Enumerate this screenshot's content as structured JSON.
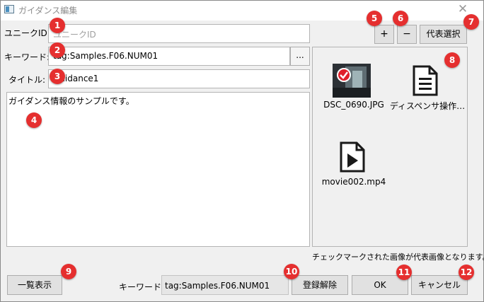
{
  "window": {
    "title": "ガイダンス編集"
  },
  "form": {
    "unique_id_label": "ユニークID:",
    "unique_id_placeholder": "ユニークID",
    "keyword_label": "キーワード:",
    "keyword_value": "tag:Samples.F06.NUM01",
    "keyword_browse": "...",
    "title_label": "タイトル:",
    "title_value": "Guidance1",
    "description": "ガイダンス情報のサンプルです。"
  },
  "media": {
    "add_label": "+",
    "remove_label": "−",
    "representative_label": "代表選択",
    "items": [
      {
        "name": "DSC_0690.JPG",
        "icon": "photo-thumbnail",
        "checked": true
      },
      {
        "name": "ディスペンサ操作…",
        "icon": "document-icon",
        "checked": false
      },
      {
        "name": "movie002.mp4",
        "icon": "video-icon",
        "checked": false
      }
    ],
    "note": "チェックマークされた画像が代表画像となります。"
  },
  "footer": {
    "list_view_label": "一覧表示",
    "keyword_label": "キーワード:",
    "keyword_value": "tag:Samples.F06.NUM01",
    "unregister_label": "登録解除",
    "ok_label": "OK",
    "cancel_label": "キャンセル"
  },
  "annotations": [
    "1",
    "2",
    "3",
    "4",
    "5",
    "6",
    "7",
    "8",
    "9",
    "10",
    "11",
    "12"
  ],
  "colors": {
    "badge": "#e52f2f",
    "window_bg": "#f0f0f0",
    "check": "#e0202a"
  }
}
